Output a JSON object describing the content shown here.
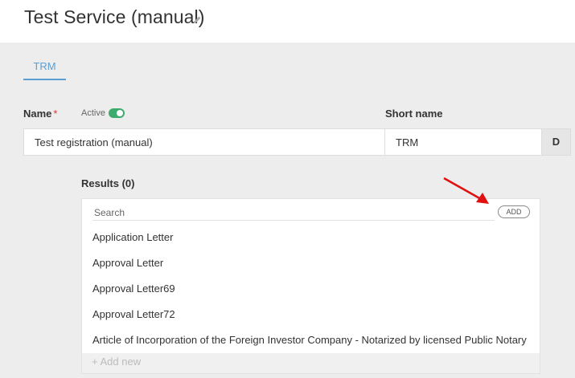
{
  "header": {
    "title": "Test Service (manual)",
    "edit_icon": "pencil-icon"
  },
  "tabs": [
    {
      "label": "TRM",
      "active": true
    }
  ],
  "form": {
    "name_label": "Name",
    "required_mark": "*",
    "active_label": "Active",
    "active_toggle_on": true,
    "short_name_label": "Short name",
    "name_value": "Test registration (manual)",
    "short_name_value": "TRM",
    "extra_cell": "D"
  },
  "results": {
    "label": "Results (0)",
    "search_placeholder": "Search",
    "add_label": "ADD",
    "items": [
      "Application Letter",
      "Approval Letter",
      "Approval Letter69",
      "Approval Letter72",
      "Article of Incorporation of the Foreign Investor Company - Notarized by licensed Public Notary"
    ],
    "add_new_label": "+ Add new"
  },
  "colors": {
    "accent": "#5a9fd4",
    "toggle": "#3dab6e",
    "required": "#e03030",
    "annotation_arrow": "#e01010"
  }
}
